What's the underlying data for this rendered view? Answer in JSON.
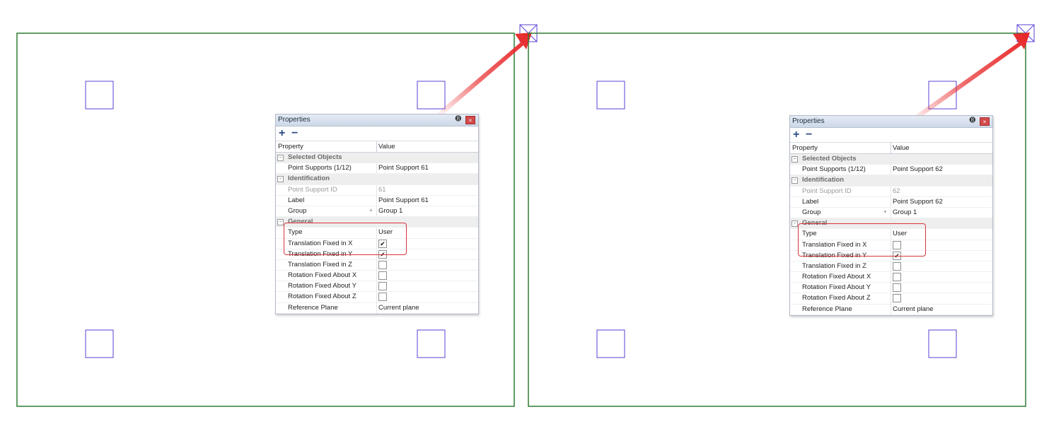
{
  "colors": {
    "frame_border": "#2e7d32",
    "support_box": "#5b3fd6",
    "highlight": "#d9343a",
    "arrow": "#e8282a"
  },
  "panels": [
    {
      "title": "Properties",
      "pin_glyph": "➑",
      "close_glyph": "×",
      "toolbar": {
        "expand": "+",
        "collapse": "−"
      },
      "header": {
        "property": "Property",
        "value": "Value"
      },
      "cat_selected": "Selected Objects",
      "point_supports": {
        "key": "Point Supports (1/12)",
        "value": "Point Support 61"
      },
      "cat_identification": "Identification",
      "support_id": {
        "key": "Point Support ID",
        "value": "61"
      },
      "label": {
        "key": "Label",
        "value": "Point Support 61"
      },
      "group": {
        "key": "Group",
        "plus": "+",
        "value": "Group 1"
      },
      "cat_general": "General",
      "type": {
        "key": "Type",
        "value": "User"
      },
      "tx": {
        "key": "Translation Fixed in X",
        "checked": true
      },
      "ty": {
        "key": "Translation Fixed in Y",
        "checked": true
      },
      "tz": {
        "key": "Translation Fixed in Z",
        "checked": false
      },
      "rx": {
        "key": "Rotation Fixed About X",
        "checked": false
      },
      "ry": {
        "key": "Rotation Fixed About Y",
        "checked": false
      },
      "rz": {
        "key": "Rotation Fixed About Z",
        "checked": false
      },
      "ref_plane": {
        "key": "Reference Plane",
        "value": "Current plane"
      }
    },
    {
      "title": "Properties",
      "pin_glyph": "➑",
      "close_glyph": "×",
      "toolbar": {
        "expand": "+",
        "collapse": "−"
      },
      "header": {
        "property": "Property",
        "value": "Value"
      },
      "cat_selected": "Selected Objects",
      "point_supports": {
        "key": "Point Supports (1/12)",
        "value": "Point Support 62"
      },
      "cat_identification": "Identification",
      "support_id": {
        "key": "Point Support ID",
        "value": "62"
      },
      "label": {
        "key": "Label",
        "value": "Point Support 62"
      },
      "group": {
        "key": "Group",
        "plus": "+",
        "value": "Group 1"
      },
      "cat_general": "General",
      "type": {
        "key": "Type",
        "value": "User"
      },
      "tx": {
        "key": "Translation Fixed in X",
        "checked": false
      },
      "ty": {
        "key": "Translation Fixed in Y",
        "checked": true
      },
      "tz": {
        "key": "Translation Fixed in Z",
        "checked": false
      },
      "rx": {
        "key": "Rotation Fixed About X",
        "checked": false
      },
      "ry": {
        "key": "Rotation Fixed About Y",
        "checked": false
      },
      "rz": {
        "key": "Rotation Fixed About Z",
        "checked": false
      },
      "ref_plane": {
        "key": "Reference Plane",
        "value": "Current plane"
      }
    }
  ]
}
